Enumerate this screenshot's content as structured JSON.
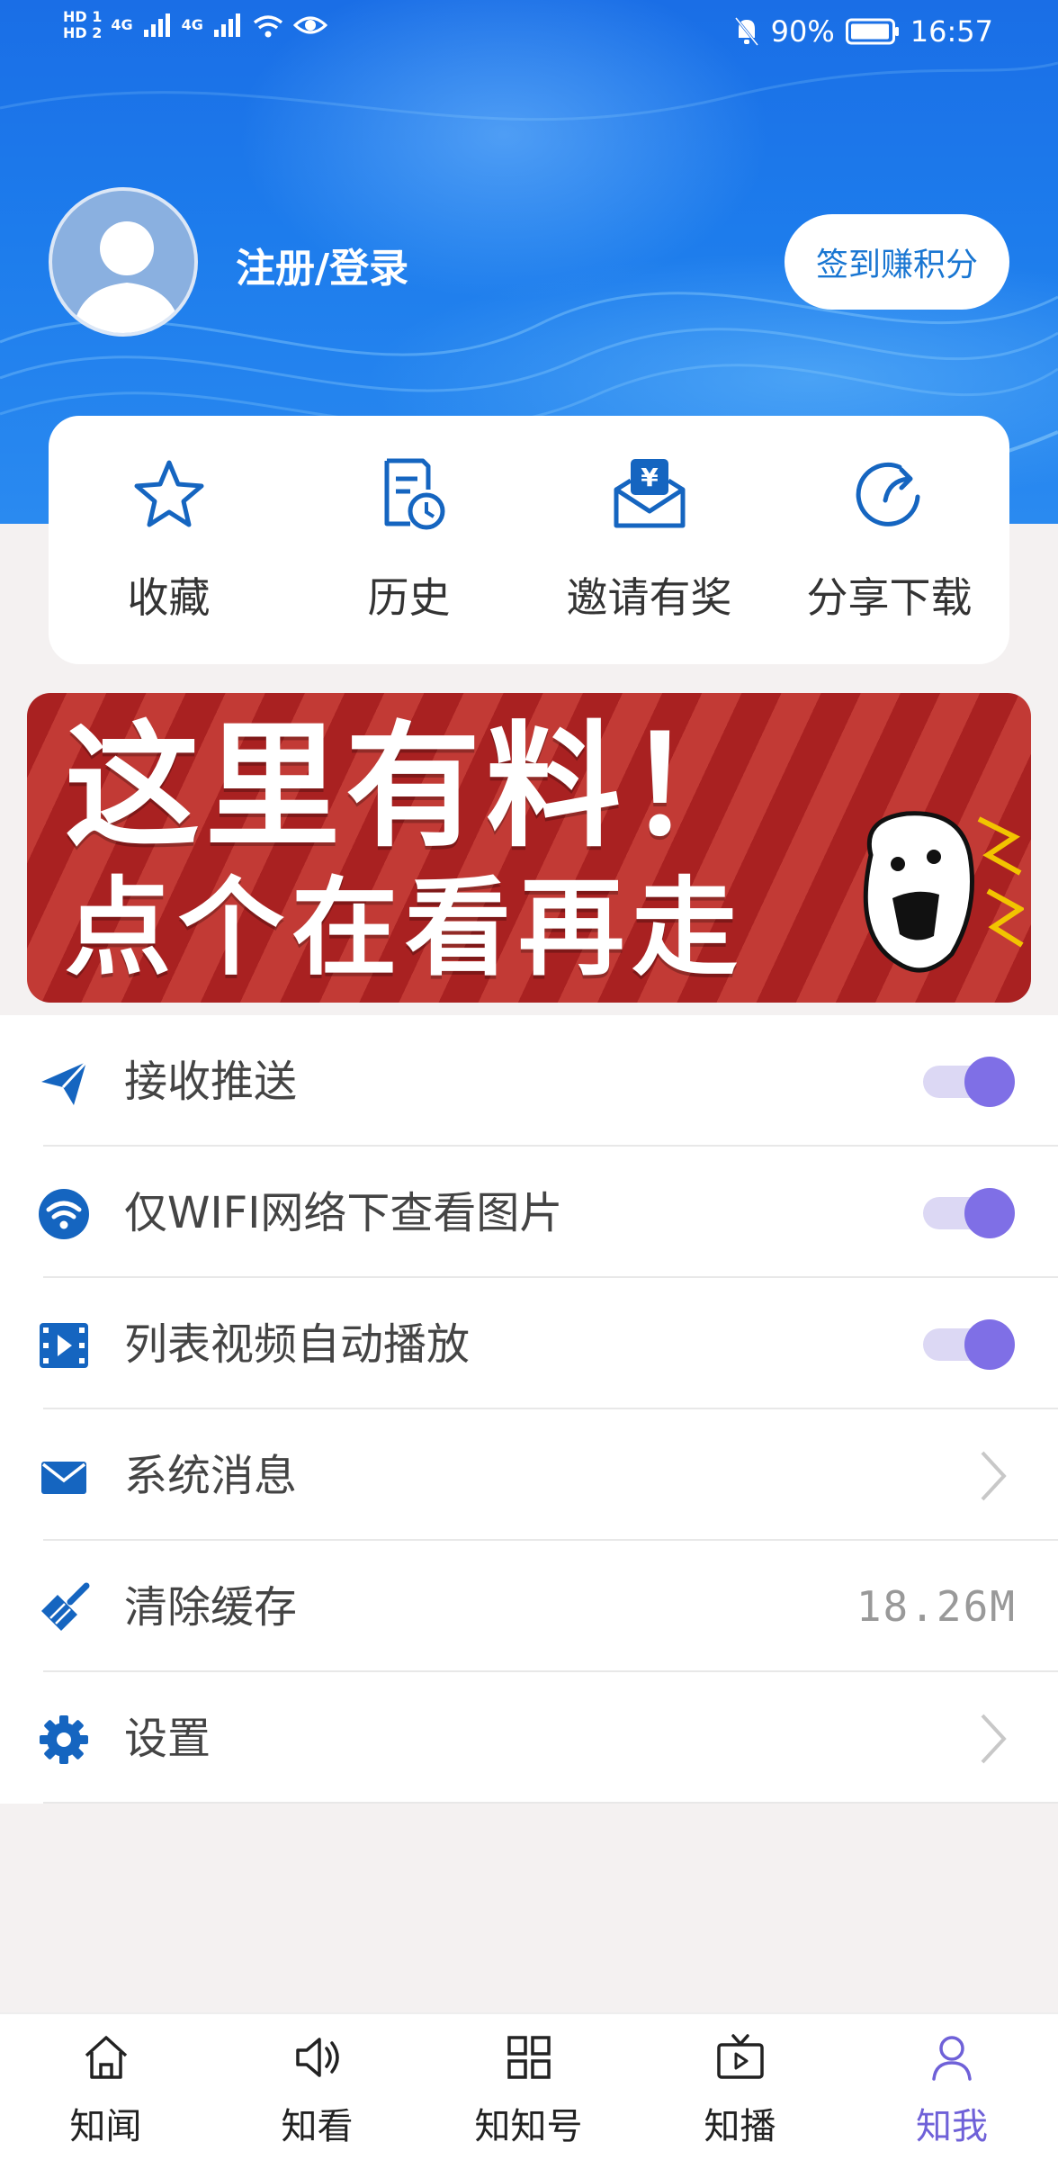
{
  "status_bar": {
    "hd1": "HD 1",
    "hd2": "HD 2",
    "network1": "4G",
    "network2": "4G",
    "battery": "90%",
    "time": "16:57"
  },
  "profile": {
    "login_label": "注册/登录",
    "checkin_button": "签到赚积分"
  },
  "quick_actions": [
    {
      "label": "收藏",
      "icon": "star-icon"
    },
    {
      "label": "历史",
      "icon": "history-icon"
    },
    {
      "label": "邀请有奖",
      "icon": "invite-reward-icon"
    },
    {
      "label": "分享下载",
      "icon": "share-icon"
    }
  ],
  "banner": {
    "line1": "这里有料！",
    "line2": "点个在看再走"
  },
  "settings": [
    {
      "label": "接收推送",
      "icon": "paper-plane-icon",
      "control": "toggle",
      "on": true
    },
    {
      "label": "仅WIFI网络下查看图片",
      "icon": "wifi-icon",
      "control": "toggle",
      "on": true
    },
    {
      "label": "列表视频自动播放",
      "icon": "video-icon",
      "control": "toggle",
      "on": true
    },
    {
      "label": "系统消息",
      "icon": "mail-icon",
      "control": "chevron"
    },
    {
      "label": "清除缓存",
      "icon": "broom-icon",
      "control": "value",
      "value": "18.26M"
    },
    {
      "label": "设置",
      "icon": "gear-icon",
      "control": "chevron"
    }
  ],
  "tabs": [
    {
      "label": "知闻",
      "icon": "home-icon",
      "active": false
    },
    {
      "label": "知看",
      "icon": "speaker-icon",
      "active": false
    },
    {
      "label": "知知号",
      "icon": "grid-icon",
      "active": false
    },
    {
      "label": "知播",
      "icon": "tv-play-icon",
      "active": false
    },
    {
      "label": "知我",
      "icon": "person-icon",
      "active": true
    }
  ],
  "colors": {
    "header_blue": "#1a6ee6",
    "icon_blue": "#1565c0",
    "toggle_on": "#7f6fe6",
    "active_tab": "#6f61d8",
    "banner_red": "#a92121"
  }
}
